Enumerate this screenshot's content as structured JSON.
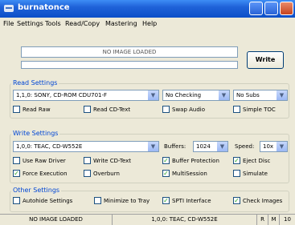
{
  "window": {
    "title": "burnatonce"
  },
  "menu": [
    "File",
    "Settings",
    "Tools",
    "Read/Copy",
    "Mastering",
    "Help"
  ],
  "status": {
    "message": "NO IMAGE LOADED",
    "progress": 0
  },
  "write_button": "Write",
  "read_settings": {
    "label": "Read Settings",
    "drive": "1,1,0: SONY, CD-ROM CDU701-F",
    "checking": "No Checking",
    "subs": "No Subs",
    "read_raw": {
      "label": "Read Raw",
      "checked": false
    },
    "read_cd_text": {
      "label": "Read CD-Text",
      "checked": false
    },
    "swap_audio": {
      "label": "Swap Audio",
      "checked": false
    },
    "simple_toc": {
      "label": "Simple TOC",
      "checked": false
    }
  },
  "write_settings": {
    "label": "Write Settings",
    "drive": "1,0,0: TEAC, CD-W552E",
    "buffers_label": "Buffers:",
    "buffers": "1024",
    "speed_label": "Speed:",
    "speed": "10x",
    "use_raw_driver": {
      "label": "Use Raw Driver",
      "checked": false
    },
    "write_cd_text": {
      "label": "Write CD-Text",
      "checked": false
    },
    "buffer_protection": {
      "label": "Buffer Protection",
      "checked": true
    },
    "eject_disc": {
      "label": "Eject Disc",
      "checked": true
    },
    "force_execution": {
      "label": "Force Execution",
      "checked": true
    },
    "overburn": {
      "label": "Overburn",
      "checked": false
    },
    "multisession": {
      "label": "MultiSession",
      "checked": true
    },
    "simulate": {
      "label": "Simulate",
      "checked": false
    }
  },
  "other_settings": {
    "label": "Other Settings",
    "autohide_settings": {
      "label": "Autohide Settings",
      "checked": false
    },
    "minimize_to_tray": {
      "label": "Minimize to Tray",
      "checked": false
    },
    "spti_interface": {
      "label": "SPTI Interface",
      "checked": true
    },
    "check_images": {
      "label": "Check Images",
      "checked": true
    }
  },
  "statusbar": {
    "image": "NO IMAGE LOADED",
    "drive": "1,0,0: TEAC, CD-W552E",
    "r": "R",
    "m": "M",
    "extra": "10"
  }
}
